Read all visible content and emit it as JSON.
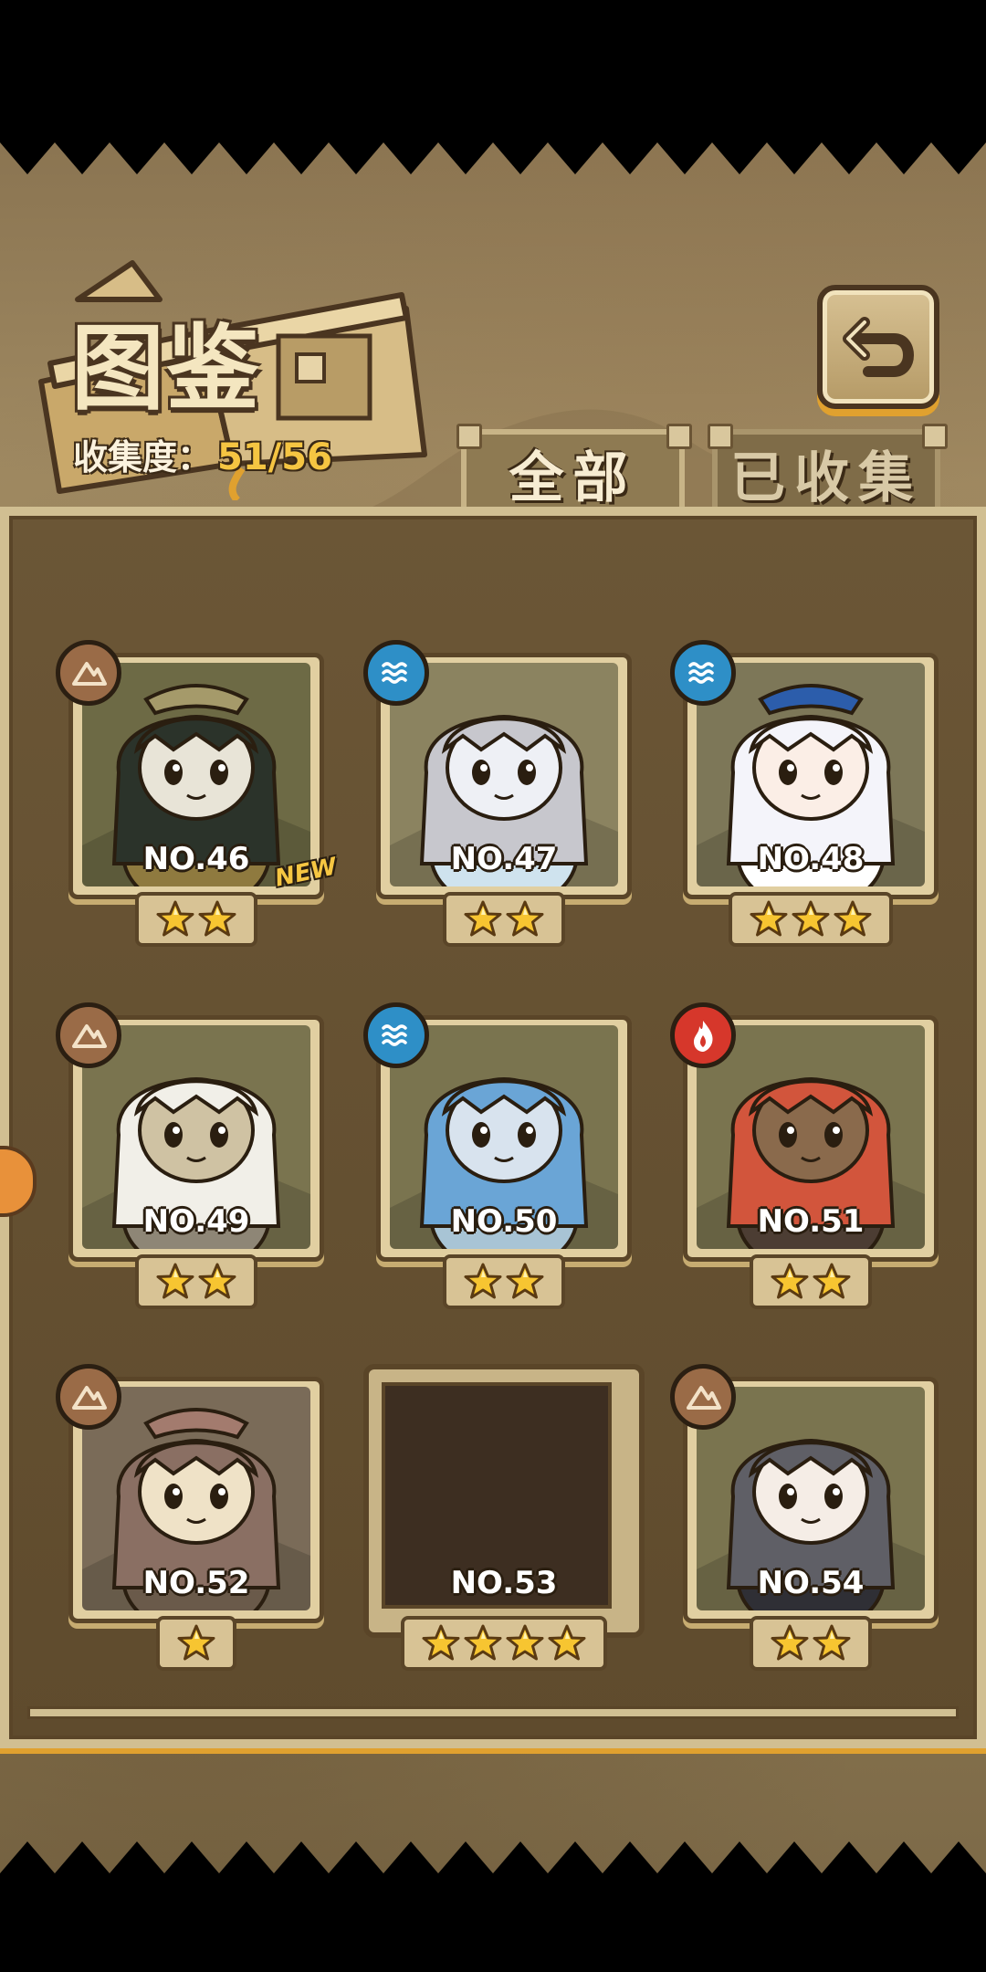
{
  "header": {
    "title": "图鉴",
    "progress_label": "收集度：",
    "progress_value": "51/56"
  },
  "tabs": [
    {
      "label": "全部",
      "active": true
    },
    {
      "label": "已收集",
      "active": false
    }
  ],
  "cards": [
    {
      "number": "NO.46",
      "element": "earth",
      "stars": 2,
      "is_new": true,
      "locked": false,
      "art": "green-haired-barrel-girl"
    },
    {
      "number": "NO.47",
      "element": "water",
      "stars": 2,
      "is_new": false,
      "locked": false,
      "art": "pale-mermaid-girl"
    },
    {
      "number": "NO.48",
      "element": "water",
      "stars": 3,
      "is_new": false,
      "locked": false,
      "art": "white-haired-bunny-girl"
    },
    {
      "number": "NO.49",
      "element": "earth",
      "stars": 2,
      "is_new": false,
      "locked": false,
      "art": "white-stone-golem-girl"
    },
    {
      "number": "NO.50",
      "element": "water",
      "stars": 2,
      "is_new": false,
      "locked": false,
      "art": "blue-ice-golem-girl"
    },
    {
      "number": "NO.51",
      "element": "fire",
      "stars": 2,
      "is_new": false,
      "locked": false,
      "art": "red-lava-golem-girl"
    },
    {
      "number": "NO.52",
      "element": "earth",
      "stars": 1,
      "is_new": false,
      "locked": false,
      "art": "mimic-chest-girl"
    },
    {
      "number": "NO.53",
      "element": null,
      "stars": 4,
      "is_new": false,
      "locked": true,
      "art": "locked-silhouette"
    },
    {
      "number": "NO.54",
      "element": "earth",
      "stars": 2,
      "is_new": false,
      "locked": false,
      "art": "grey-mouse-girl"
    }
  ],
  "new_badge_label": "NEW",
  "colors": {
    "accent_gold": "#f5c542",
    "panel_brown": "#5f4b2d",
    "frame_beige": "#e1cfa1",
    "earth": "#9a6b47",
    "water": "#2e8fc7",
    "fire": "#d6372b"
  }
}
